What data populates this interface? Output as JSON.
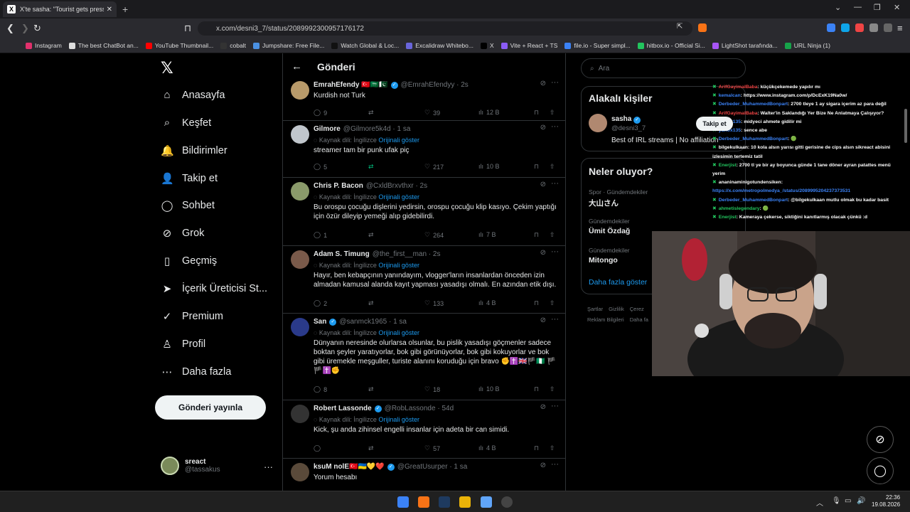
{
  "browser": {
    "tab_title": "X'te sasha: \"Tourist gets pressed",
    "url": "x.com/desni3_7/status/2089992300957176172",
    "bookmarks": [
      {
        "label": "Instagram",
        "color": "#e1306c"
      },
      {
        "label": "The best ChatBot an...",
        "color": "#dddddd"
      },
      {
        "label": "YouTube Thumbnail...",
        "color": "#ff0000"
      },
      {
        "label": "cobalt",
        "color": "#333333"
      },
      {
        "label": "Jumpshare: Free File...",
        "color": "#4a90e2"
      },
      {
        "label": "Watch Global & Loc...",
        "color": "#111111"
      },
      {
        "label": "Excalidraw Whitebo...",
        "color": "#6965db"
      },
      {
        "label": "X",
        "color": "#000000"
      },
      {
        "label": "Vite + React + TS",
        "color": "#8b5cf6"
      },
      {
        "label": "file.io - Super simpl...",
        "color": "#3b82f6"
      },
      {
        "label": "hitbox.io - Official Si...",
        "color": "#22c55e"
      },
      {
        "label": "LightShot tarafında...",
        "color": "#a855f7"
      },
      {
        "label": "URL Ninja (1)",
        "color": "#16a34a"
      }
    ]
  },
  "nav": {
    "logo": "𝕏",
    "items": [
      {
        "label": "Anasayfa",
        "icon": "⌂"
      },
      {
        "label": "Keşfet",
        "icon": "⌕"
      },
      {
        "label": "Bildirimler",
        "icon": "🔔"
      },
      {
        "label": "Takip et",
        "icon": "👤"
      },
      {
        "label": "Sohbet",
        "icon": "◯"
      },
      {
        "label": "Grok",
        "icon": "⊘"
      },
      {
        "label": "Geçmiş",
        "icon": "▯"
      },
      {
        "label": "İçerik Üreticisi St...",
        "icon": "➤"
      },
      {
        "label": "Premium",
        "icon": "✓"
      },
      {
        "label": "Profil",
        "icon": "♙"
      },
      {
        "label": "Daha fazla",
        "icon": "⋯"
      }
    ],
    "post_button": "Gönderi yayınla",
    "account": {
      "name": "sreact",
      "handle": "@tassakus"
    }
  },
  "main": {
    "title": "Gönderi",
    "translate_label": "Kaynak dili: İngilizce",
    "translate_link": "Orijinali göster",
    "tweets": [
      {
        "name": "EmrahEfendy 🇹🇷🇸🇦🇵🇰",
        "handle": "@EmrahEfendyy · 2s",
        "verified": true,
        "translated": false,
        "text": "Kurdish not Turk",
        "replies": "9",
        "reposts": "",
        "likes": "39",
        "views": "12 B",
        "avatar": "#b89a6a"
      },
      {
        "name": "Gilmore",
        "handle": "@Gilmore5k4d · 1 sa",
        "verified": false,
        "translated": true,
        "text": "streamer tam bir punk ufak piç",
        "replies": "5",
        "reposts": "",
        "likes": "217",
        "views": "10 B",
        "avatar": "#c0c6cc"
      },
      {
        "name": "Chris P. Bacon",
        "handle": "@CxldBrxvthxr · 2s",
        "verified": false,
        "translated": true,
        "text": "Bu orospu çocuğu dişlerini yedirsin, orospu çocuğu klip kasıyo. Çekim yaptığı için özür dileyip yemeği alıp gidebilirdi.",
        "replies": "1",
        "reposts": "",
        "likes": "264",
        "views": "7 B",
        "avatar": "#8a9a6a"
      },
      {
        "name": "Adam S. Timung",
        "handle": "@the_first__man · 2s",
        "verified": false,
        "translated": true,
        "text": "Hayır, ben kebapçının yanındayım, vlogger'ların insanlardan önceden izin almadan kamusal alanda kayıt yapması yasadışı olmalı. En azından etik dışı.",
        "replies": "2",
        "reposts": "",
        "likes": "133",
        "views": "4 B",
        "avatar": "#7a5a4a"
      },
      {
        "name": "San",
        "handle": "@sanmck1965 · 1 sa",
        "verified": true,
        "translated": true,
        "text": "Dünyanın neresinde olurlarsa olsunlar, bu pislik yasadışı göçmenler sadece boktan şeyler yaratıyorlar, bok gibi görünüyorlar, bok gibi kokuyorlar ve bok gibi üremekle meşguller, turiste alanını koruduğu için bravo ✊✝️🇬🇧🏴🇳🇬 🏴🏴✝️✊",
        "replies": "8",
        "reposts": "",
        "likes": "18",
        "views": "10 B",
        "avatar": "#2a3a8a"
      },
      {
        "name": "Robert Lassonde",
        "handle": "@RobLassonde · 54d",
        "verified": true,
        "translated": true,
        "text": "Kick, şu anda zihinsel engelli insanlar için adeta bir can simidi.",
        "replies": "",
        "reposts": "",
        "likes": "57",
        "views": "4 B",
        "avatar": "#333333"
      },
      {
        "name": "ksuM nolE🇹🇷🇺🇦💛❤️",
        "handle": "@GreatUsurper · 1 sa",
        "verified": true,
        "translated": false,
        "text": "Yorum hesabı",
        "replies": "",
        "reposts": "",
        "likes": "",
        "views": "",
        "avatar": "#5a4a3a"
      }
    ]
  },
  "right": {
    "search_placeholder": "Ara",
    "related_title": "Alakalı kişiler",
    "person": {
      "name": "sasha",
      "handle": "@desni3_7",
      "bio": "Best of IRL streams | No affiliation",
      "follow": "Takip et"
    },
    "trends_title": "Neler oluyor?",
    "trends": [
      {
        "category": "Spor · Gündemdekiler",
        "name": "大山さん"
      },
      {
        "category": "Gündemdekiler",
        "name": "Ümit Özdağ"
      },
      {
        "category": "Gündemdekiler",
        "name": "Mitongo"
      }
    ],
    "show_more": "Daha fazla göster",
    "footer1": [
      "Şartlar",
      "Gizlilik",
      "Çerez"
    ],
    "footer2": [
      "Reklam Bilgileri",
      "Daha fa"
    ]
  },
  "chat": [
    {
      "user": "ArifGayimalBaba",
      "user_color": "#ef4444",
      "msg": ": küçükçekemede yapılır mı"
    },
    {
      "user": "kemalcan",
      "user_color": "#3b82f6",
      "msg": ": https://www.instagram.com/p/DcExK19Na0w/"
    },
    {
      "user": "Derbeder_MuhammedBonpart",
      "user_color": "#3b82f6",
      "msg": ": 2700 tleye 1 ay sigara içerim az para değil"
    },
    {
      "user": "ArifGayimalBaba",
      "user_color": "#ef4444",
      "msg": ": Walter'in Saklandığı Yer Bize Ne Anlatmaya Çalışıyor?"
    },
    {
      "user": "yunox135",
      "user_color": "#3b82f6",
      "msg": ": midyeci ahmete gidilir mi"
    },
    {
      "user": "yunox135",
      "user_color": "#3b82f6",
      "msg": ": sence abe"
    },
    {
      "user": "Derbeder_MuhammedBonpart",
      "user_color": "#3b82f6",
      "msg": ": 🟢"
    },
    {
      "user": "bilgekulkaan",
      "user_color": "#ffffff",
      "msg": ": 10 kola alsın yarısı gitti gerisine de cips alsın sikreact abisini"
    },
    {
      "user": "",
      "user_color": "#ffffff",
      "msg": "izlesimin tertemiz tatil"
    },
    {
      "user": "Enerjist",
      "user_color": "#22c55e",
      "msg": ": 2700 tl ye bir ay boyunca günde 1 tane döner ayran patattes menü"
    },
    {
      "user": "",
      "user_color": "#ffffff",
      "msg": "yerim"
    },
    {
      "user": "ananinaminigotundensiken",
      "user_color": "#ffffff",
      "msg": ":"
    },
    {
      "user": "",
      "user_color": "#3b82f6",
      "msg": "https://x.com/metropolmedya_/status/2089995204237373531"
    },
    {
      "user": "Derbeder_MuhammedBonpart",
      "user_color": "#3b82f6",
      "msg": ": @bilgekulkaan mutlu olmak bu kadar basit"
    },
    {
      "user": "ahmetislegendary",
      "user_color": "#22c55e",
      "msg": ": 🟢"
    },
    {
      "user": "Enerjist",
      "user_color": "#22c55e",
      "msg": ": Kameraya çekerse, siktiğini kanıtlarmış olacak çünkü :d"
    }
  ],
  "taskbar": {
    "time": "22:36",
    "date": "19.08.2026"
  }
}
